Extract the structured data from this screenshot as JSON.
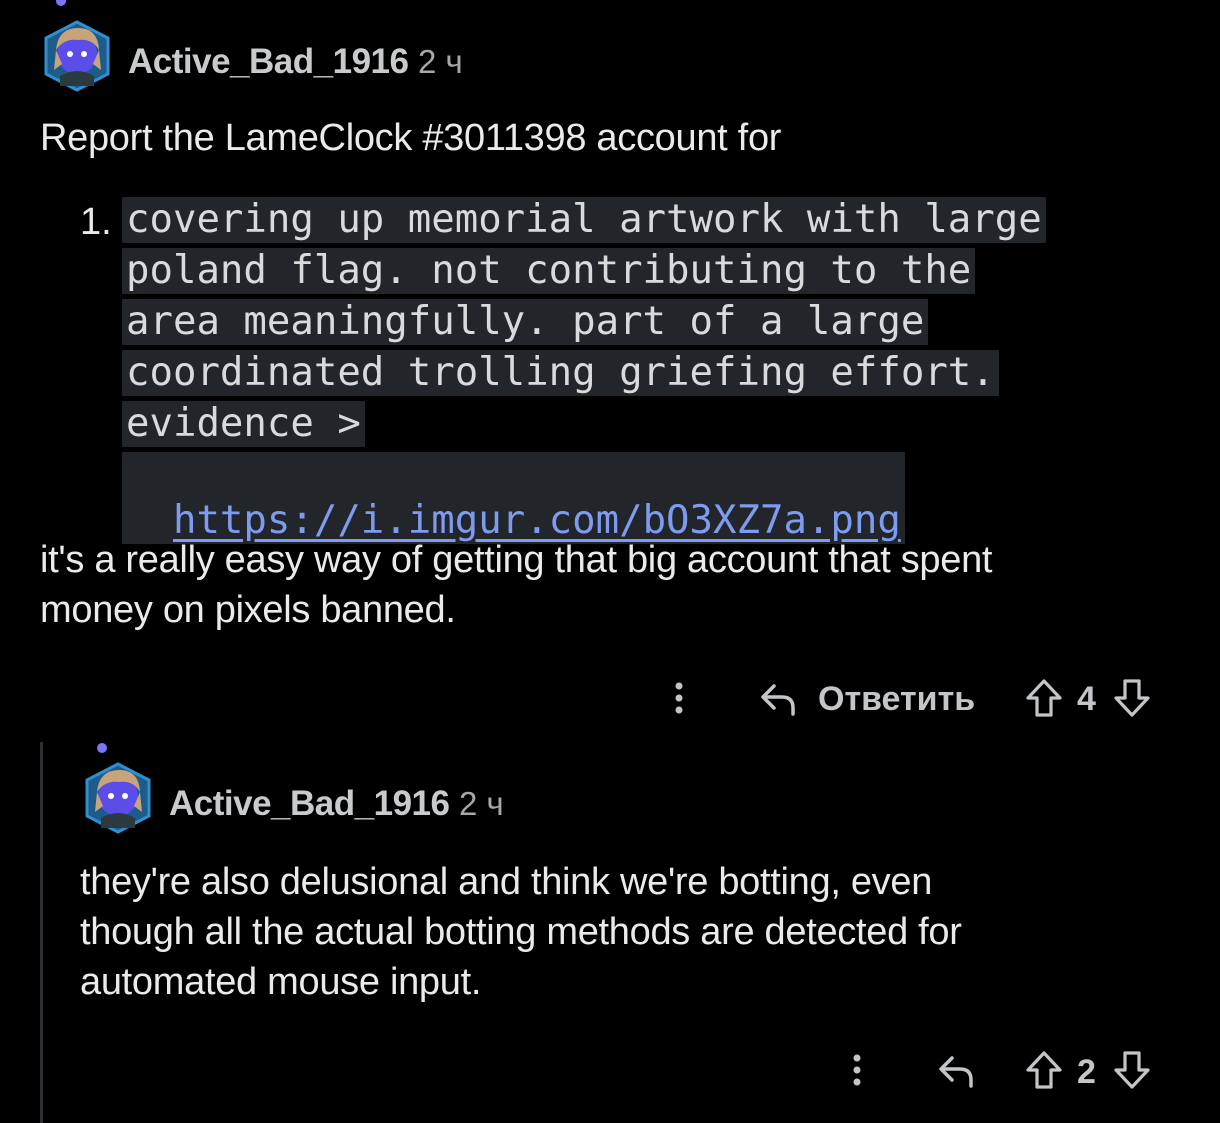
{
  "comments": [
    {
      "author": "Active_Bad_1916",
      "time": "2 ч",
      "intro": "Report the LameClock #3011398 account for",
      "list_number": "1.",
      "code_lines": [
        "covering up memorial artwork with large",
        "poland flag. not contributing to the",
        "area meaningfully. part of a large",
        "coordinated trolling griefing effort.",
        "evidence >"
      ],
      "code_link": "https://i.imgur.com/bO3XZ7a.png",
      "outro_lines": [
        "it's a really easy way of getting that big account that spent",
        "money on pixels banned."
      ],
      "reply_label": "Ответить",
      "score": "4"
    },
    {
      "author": "Active_Bad_1916",
      "time": "2 ч",
      "body_lines": [
        "they're also delusional and think we're botting, even",
        "though all the actual botting methods are detected for",
        "automated mouse input."
      ],
      "score": "2"
    }
  ],
  "icons": {
    "more": "more-vertical-icon",
    "reply": "reply-arrow-icon",
    "upvote": "upvote-arrow-icon",
    "downvote": "downvote-arrow-icon"
  },
  "colors": {
    "background": "#000000",
    "text": "#e9eaec",
    "code_bg": "#22262a",
    "link": "#7d9bf0",
    "muted": "#a5a8ab",
    "avatar_accent": "#5b4de8"
  }
}
